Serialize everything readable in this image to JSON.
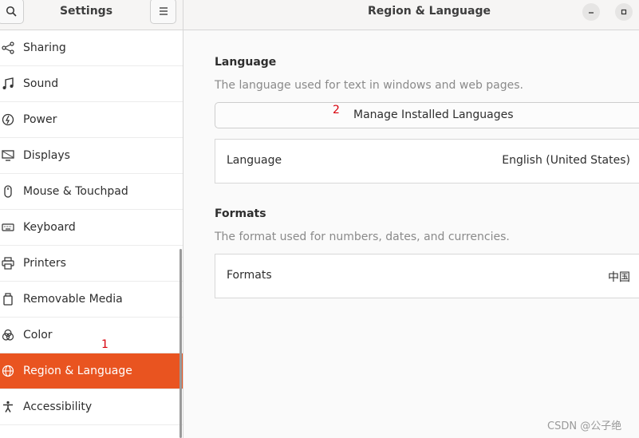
{
  "sidebar": {
    "title": "Settings",
    "search_icon": "search-icon",
    "menu_icon": "hamburger-menu-icon",
    "items": [
      {
        "label": "Sharing",
        "icon": "share-icon"
      },
      {
        "label": "Sound",
        "icon": "music-note-icon"
      },
      {
        "label": "Power",
        "icon": "power-icon"
      },
      {
        "label": "Displays",
        "icon": "display-icon"
      },
      {
        "label": "Mouse & Touchpad",
        "icon": "mouse-icon"
      },
      {
        "label": "Keyboard",
        "icon": "keyboard-icon"
      },
      {
        "label": "Printers",
        "icon": "printer-icon"
      },
      {
        "label": "Removable Media",
        "icon": "removable-media-icon"
      },
      {
        "label": "Color",
        "icon": "color-icon"
      },
      {
        "label": "Region & Language",
        "icon": "globe-icon",
        "active": true
      },
      {
        "label": "Accessibility",
        "icon": "accessibility-icon"
      }
    ]
  },
  "header": {
    "title": "Region & Language"
  },
  "language_section": {
    "title": "Language",
    "description": "The language used for text in windows and web pages.",
    "manage_button": "Manage Installed Languages",
    "row_label": "Language",
    "row_value": "English (United States)"
  },
  "formats_section": {
    "title": "Formats",
    "description": "The format used for numbers, dates, and currencies.",
    "row_label": "Formats",
    "row_value": "中国"
  },
  "annotations": {
    "one": "1",
    "two": "2"
  },
  "watermark": "CSDN @公子绝",
  "colors": {
    "accent": "#e95420",
    "annotation": "#d8000c"
  }
}
